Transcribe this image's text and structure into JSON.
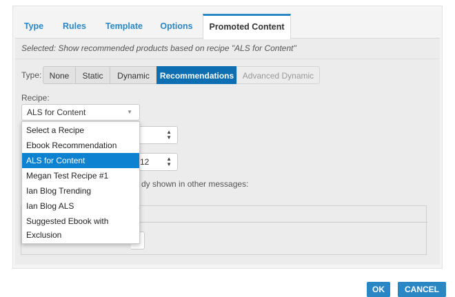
{
  "tabs": [
    {
      "label": "Type"
    },
    {
      "label": "Rules"
    },
    {
      "label": "Template"
    },
    {
      "label": "Options"
    },
    {
      "label": "Promoted Content"
    }
  ],
  "active_tab": "Promoted Content",
  "selected_text": "Selected: Show recommended products based on recipe \"ALS for Content\"",
  "type": {
    "label": "Type:",
    "options": [
      "None",
      "Static",
      "Dynamic",
      "Recommendations",
      "Advanced Dynamic"
    ],
    "selected": "Recommendations",
    "disabled": [
      "Advanced Dynamic"
    ]
  },
  "recipe": {
    "label": "Recipe:",
    "value": "ALS for Content",
    "options": [
      "Select a Recipe",
      "Ebook Recommendation",
      "ALS for Content",
      "Megan Test Recipe #1",
      "Ian Blog Trending",
      "Ian Blog ALS",
      "Suggested Ebook with",
      "Exclusion"
    ]
  },
  "stepper2_value": "12",
  "behind_text": "dy shown in other messages:",
  "buttons": {
    "ok": "OK",
    "cancel": "CANCEL"
  },
  "colors": {
    "accent": "#2b86c4",
    "selected_segment": "#0d6fb1",
    "dropdown_highlight": "#0d82d0"
  }
}
